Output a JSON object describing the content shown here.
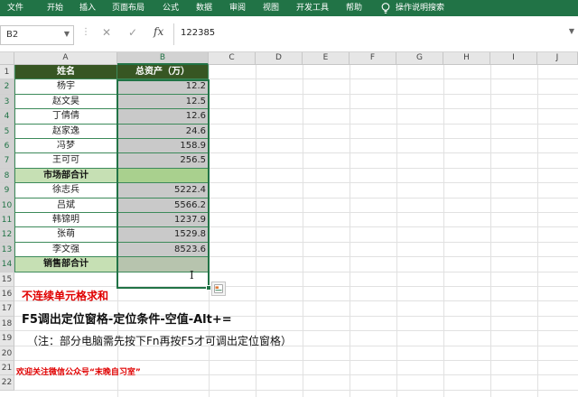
{
  "ribbon": {
    "tabs": [
      "文件",
      "开始",
      "插入",
      "页面布局",
      "公式",
      "数据",
      "审阅",
      "视图",
      "开发工具",
      "帮助"
    ],
    "tell_me": "操作说明搜索"
  },
  "formula_bar": {
    "name_box": "B2",
    "dots": "⋮",
    "cancel_icon": "✕",
    "enter_icon": "✓",
    "fx": "fx",
    "content": "122385"
  },
  "columns": [
    "A",
    "B",
    "C",
    "D",
    "E",
    "F",
    "G",
    "H",
    "I",
    "J"
  ],
  "rows": [
    "1",
    "2",
    "3",
    "4",
    "5",
    "6",
    "7",
    "8",
    "9",
    "10",
    "11",
    "12",
    "13",
    "14",
    "15",
    "16",
    "17",
    "18",
    "19",
    "20",
    "21",
    "22"
  ],
  "table": {
    "header": {
      "a": "姓名",
      "b": "总资产（万）"
    },
    "body": [
      {
        "a": "杨宇",
        "b": "12.2"
      },
      {
        "a": "赵文昊",
        "b": "12.5"
      },
      {
        "a": "丁倩倩",
        "b": "12.6"
      },
      {
        "a": "赵家逸",
        "b": "24.6"
      },
      {
        "a": "冯梦",
        "b": "158.9"
      },
      {
        "a": "王可可",
        "b": "256.5"
      },
      {
        "a": "市场部合计",
        "b": ""
      },
      {
        "a": "徐志兵",
        "b": "5222.4"
      },
      {
        "a": "吕斌",
        "b": "5566.2"
      },
      {
        "a": "韩锦明",
        "b": "1237.9"
      },
      {
        "a": "张萌",
        "b": "1529.8"
      },
      {
        "a": "李文强",
        "b": "8523.6"
      },
      {
        "a": "销售部合计",
        "b": ""
      }
    ]
  },
  "notes": {
    "line1": "不连续单元格求和",
    "line2": "F5调出定位窗格-定位条件-空值-Alt+=",
    "line3": "（注：部分电脑需先按下Fn再按F5才可调出定位窗格）",
    "line4": "欢迎关注微信公众号“末晚自习室”"
  },
  "colors": {
    "accent": "#217346",
    "header_fill": "#375623",
    "subtotal_fill": "#c6e0b4",
    "note_red": "#e00000"
  }
}
